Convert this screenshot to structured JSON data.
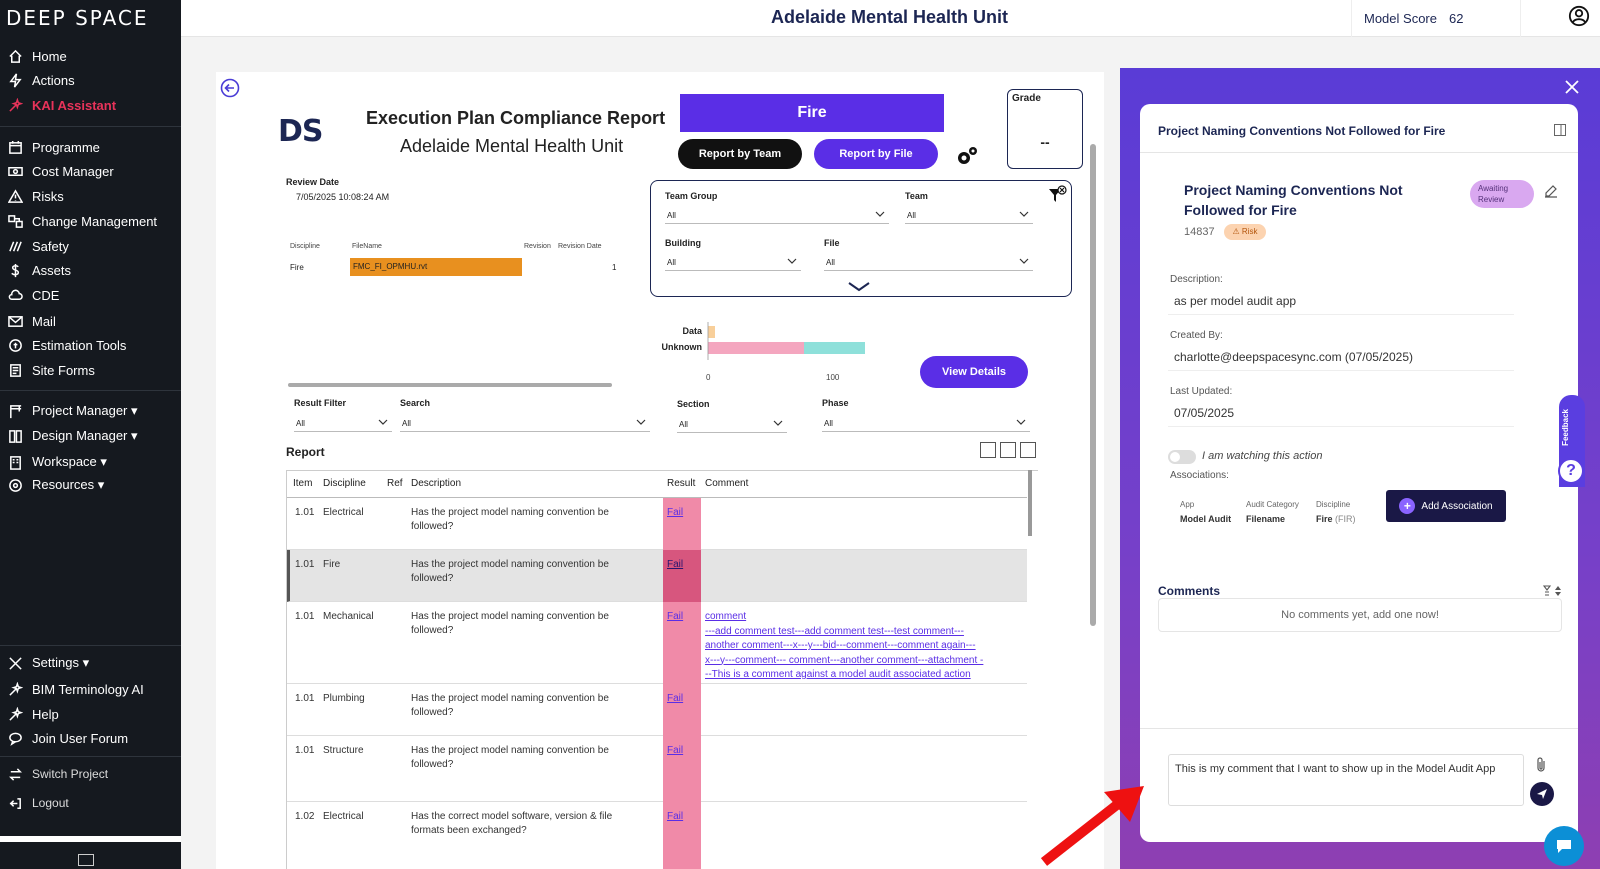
{
  "sidebar": {
    "logo": "DEEP SPACE",
    "items": [
      {
        "label": "Home",
        "icon": "home-icon"
      },
      {
        "label": "Actions",
        "icon": "bolt-icon"
      },
      {
        "label": "KAI Assistant",
        "icon": "sparkle-icon",
        "active": true
      },
      {
        "label": "Programme",
        "icon": "calendar-icon"
      },
      {
        "label": "Cost Manager",
        "icon": "cash-icon"
      },
      {
        "label": "Risks",
        "icon": "warning-icon"
      },
      {
        "label": "Change Management",
        "icon": "change-icon"
      },
      {
        "label": "Safety",
        "icon": "safety-icon"
      },
      {
        "label": "Assets",
        "icon": "dollar-icon"
      },
      {
        "label": "CDE",
        "icon": "cloud-icon"
      },
      {
        "label": "Mail",
        "icon": "mail-icon"
      },
      {
        "label": "Estimation Tools",
        "icon": "estimate-icon"
      },
      {
        "label": "Site Forms",
        "icon": "form-icon"
      },
      {
        "label": "Project Manager ▾",
        "icon": "crane-icon"
      },
      {
        "label": "Design Manager ▾",
        "icon": "design-icon"
      },
      {
        "label": "Workspace ▾",
        "icon": "building-icon"
      },
      {
        "label": "Resources ▾",
        "icon": "resources-icon"
      },
      {
        "label": "Settings ▾",
        "icon": "tools-icon"
      },
      {
        "label": "BIM Terminology AI",
        "icon": "sparkle-icon"
      },
      {
        "label": "Help",
        "icon": "help-icon"
      },
      {
        "label": "Join User Forum",
        "icon": "forum-icon"
      },
      {
        "label": "Switch Project",
        "icon": "switch-icon"
      },
      {
        "label": "Logout",
        "icon": "logout-icon"
      }
    ]
  },
  "topbar": {
    "title": "Adelaide Mental Health Unit",
    "score_label": "Model Score",
    "score_value": "62"
  },
  "report": {
    "logo": "DS",
    "title": "Execution Plan Compliance Report",
    "subtitle": "Adelaide Mental Health Unit",
    "discipline_banner": "Fire",
    "btn_team": "Report by Team",
    "btn_file": "Report by File",
    "grade_label": "Grade",
    "grade_value": "--",
    "review_label": "Review Date",
    "review_value": "7/05/2025 10:08:24 AM",
    "file_headers": {
      "discipline": "Discipline",
      "filename": "FileName",
      "revision": "Revision",
      "revision_date": "Revision Date"
    },
    "file_row": {
      "discipline": "Fire",
      "filename": "FMC_FI_OPMHU.rvt",
      "revision": "1"
    },
    "filters": {
      "team_group": {
        "label": "Team Group",
        "value": "All"
      },
      "team": {
        "label": "Team",
        "value": "All"
      },
      "building": {
        "label": "Building",
        "value": "All"
      },
      "file": {
        "label": "File",
        "value": "All"
      }
    },
    "chart": {
      "label_data": "Data",
      "label_unknown": "Unknown",
      "tick0": "0",
      "tick100": "100"
    },
    "view_details": "View Details",
    "lower_filters": {
      "result": {
        "label": "Result Filter",
        "value": "All"
      },
      "search": {
        "label": "Search",
        "value": "All"
      },
      "section": {
        "label": "Section",
        "value": "All"
      },
      "phase": {
        "label": "Phase",
        "value": "All"
      }
    },
    "table_title": "Report",
    "columns": {
      "item": "Item",
      "discipline": "Discipline",
      "ref": "Ref",
      "description": "Description",
      "result": "Result",
      "comment": "Comment"
    },
    "rows": [
      {
        "item": "1.01",
        "discipline": "Electrical",
        "desc1": "Has the project model naming convention be",
        "desc2": "followed?",
        "result": "Fail"
      },
      {
        "item": "1.01",
        "discipline": "Fire",
        "desc1": "Has the project model naming convention be",
        "desc2": "followed?",
        "result": "Fail"
      },
      {
        "item": "1.01",
        "discipline": "Mechanical",
        "desc1": "Has the project model naming convention be",
        "desc2": "followed?",
        "result": "Fail",
        "comments": [
          "comment",
          "---add comment test---add comment test---test comment---",
          "another comment---x---y---bid---comment---comment again---",
          "x---y---comment--- comment---another comment---attachment -",
          "--This is a comment against a model audit associated action"
        ]
      },
      {
        "item": "1.01",
        "discipline": "Plumbing",
        "desc1": "Has the project model naming convention be",
        "desc2": "followed?",
        "result": "Fail"
      },
      {
        "item": "1.01",
        "discipline": "Structure",
        "desc1": "Has the project model naming convention be",
        "desc2": "followed?",
        "result": "Fail"
      },
      {
        "item": "1.02",
        "discipline": "Electrical",
        "desc1": "Has the correct model software, version & file",
        "desc2": "formats been exchanged?",
        "result": "Fail"
      }
    ]
  },
  "panel": {
    "header": "Project Naming Conventions Not Followed for Fire",
    "title": "Project Naming Conventions Not Followed for Fire",
    "status": "Awaiting Review",
    "id": "14837",
    "risk": "⚠ Risk",
    "description_label": "Description:",
    "description_value": "as per model audit app",
    "created_label": "Created By:",
    "created_value": "charlotte@deepspacesync.com (07/05/2025)",
    "updated_label": "Last Updated:",
    "updated_value": "07/05/2025",
    "watch_label": "I am watching this action",
    "assoc_label": "Associations:",
    "assoc": {
      "app_h": "App",
      "app_v": "Model Audit",
      "cat_h": "Audit Category",
      "cat_v": "Filename",
      "disc_h": "Discipline",
      "disc_v": "Fire",
      "disc_code": "(FIR)"
    },
    "add_assoc": "Add Association",
    "comments_label": "Comments",
    "comments_empty": "No comments yet, add one now!",
    "comment_draft": "This is my comment that I want to show up in the Model Audit App",
    "feedback": "Feedback"
  },
  "colors": {
    "accent": "#5a2ee6",
    "sidebar": "#15191f",
    "active": "#e8335a",
    "fail": "#f08aa8",
    "file_bar": "#e8901f"
  }
}
